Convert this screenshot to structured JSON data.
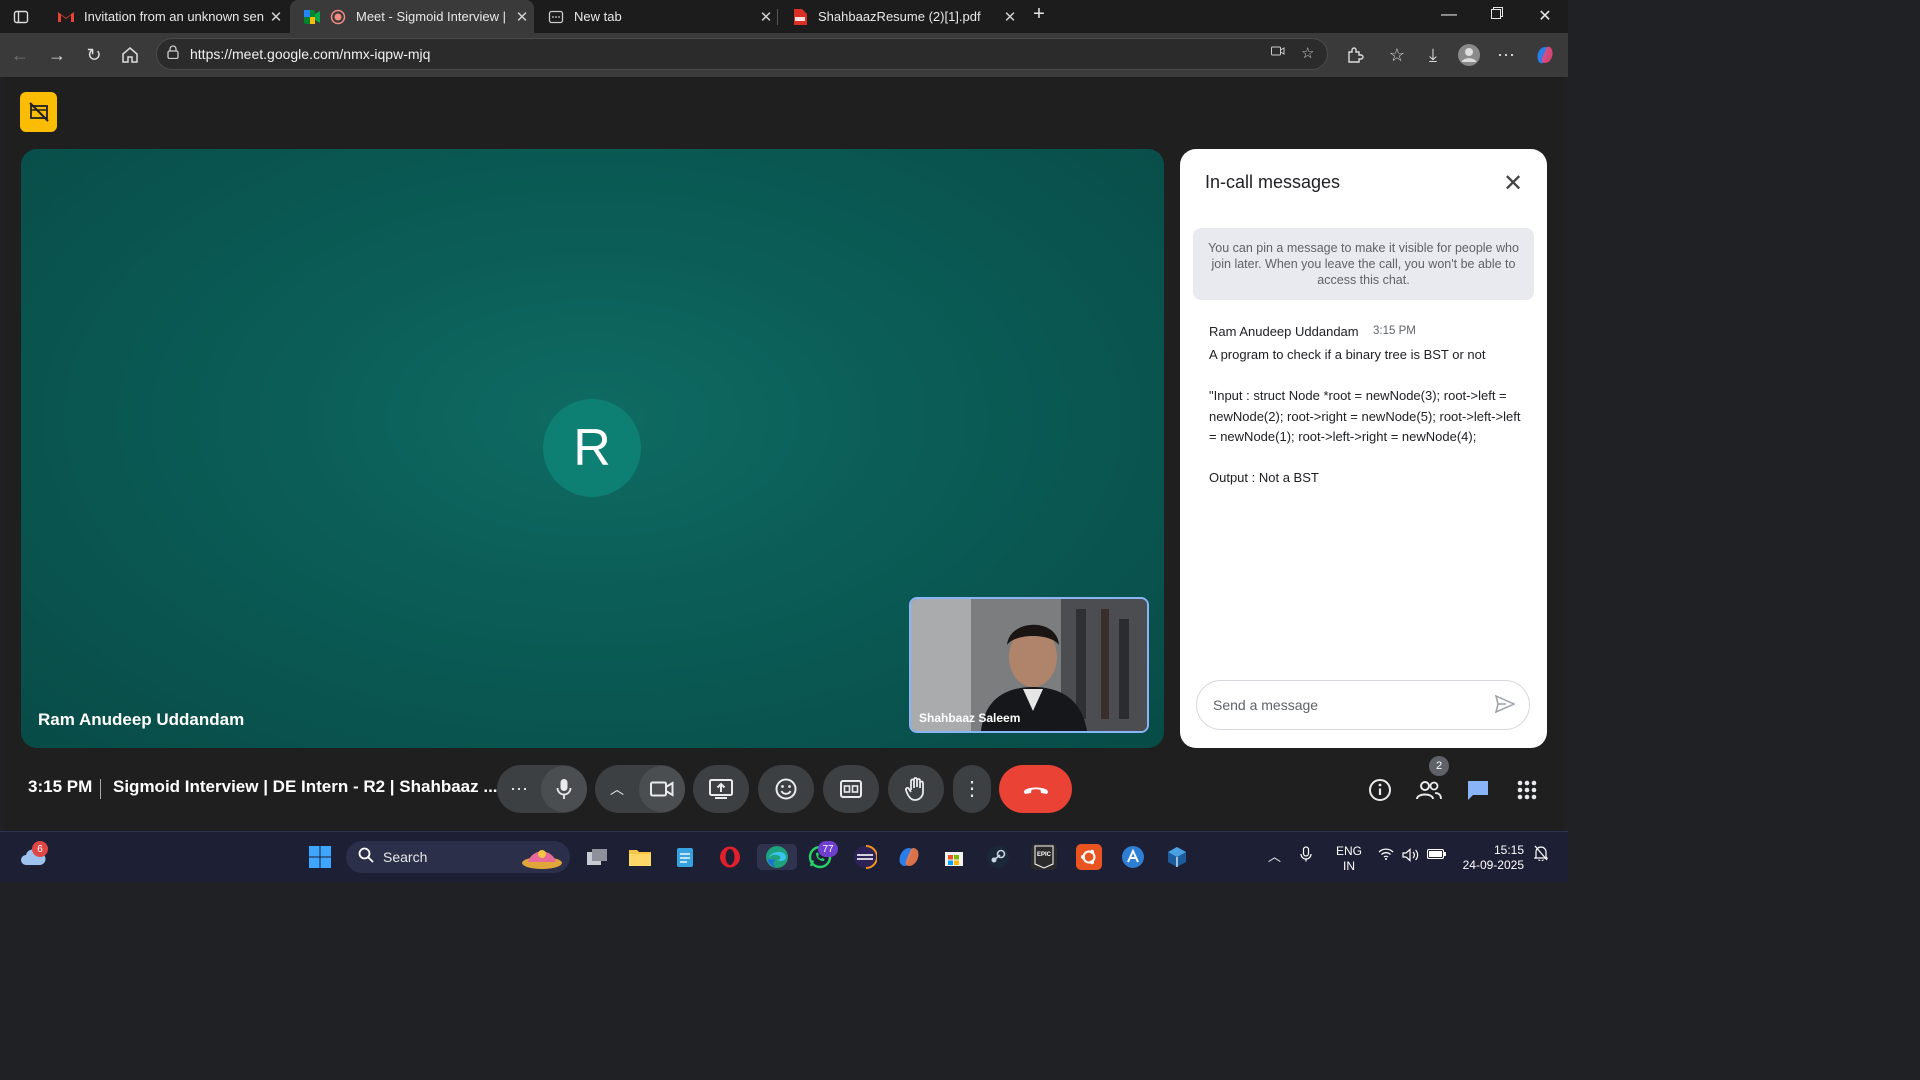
{
  "browser": {
    "tabs": [
      {
        "title": "Invitation from an unknown sende",
        "icon": "gmail-icon",
        "active": false
      },
      {
        "title": "Meet - Sigmoid Interview | D",
        "icon": "meet-icon",
        "active": true
      },
      {
        "title": "New tab",
        "icon": "newtab-icon",
        "active": false
      },
      {
        "title": "ShahbaazResume (2)[1].pdf",
        "icon": "pdf-icon",
        "active": false
      }
    ],
    "new_tab_glyph": "+",
    "url": "https://meet.google.com/nmx-iqpw-mjq"
  },
  "meet": {
    "avatar_initial": "R",
    "stage_name": "Ram Anudeep Uddandam",
    "self_name": "Shahbaaz Saleem",
    "clock": "3:15 PM",
    "meeting_title": "Sigmoid Interview | DE Intern - R2 | Shahbaaz ...",
    "people_count": "2"
  },
  "chat": {
    "title": "In-call messages",
    "info": "You can pin a message to make it visible for people who join later. When you leave the call, you won't be able to access this chat.",
    "message": {
      "sender": "Ram Anudeep Uddandam",
      "time": "3:15 PM",
      "body": "A program to check if a binary tree is BST or not\n\n\"Input : struct Node *root = newNode(3); root->left = newNode(2); root->right = newNode(5); root->left->left = newNode(1); root->left->right = newNode(4);\n\nOutput : Not a BST"
    },
    "placeholder": "Send a message"
  },
  "taskbar": {
    "weather_badge": "6",
    "search_label": "Search",
    "whatsapp_badge": "77",
    "lang_line1": "ENG",
    "lang_line2": "IN",
    "time": "15:15",
    "date": "24-09-2025"
  },
  "colors": {
    "stage": "#0b5d57",
    "avatar": "#0d7f73",
    "end_call": "#ea4335",
    "rec_badge": "#fbbc04"
  }
}
